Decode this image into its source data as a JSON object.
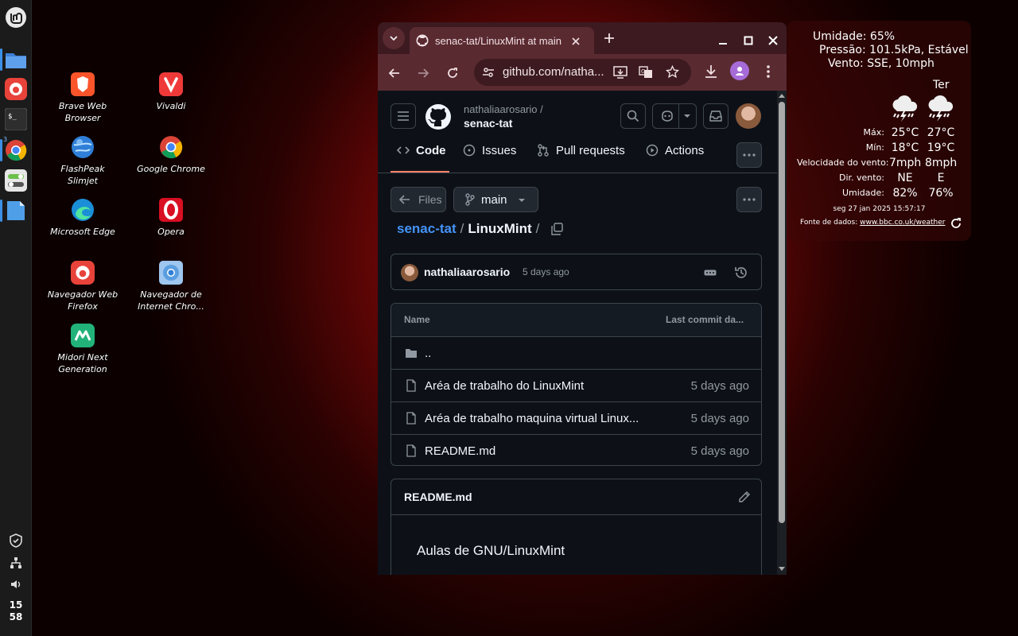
{
  "panel": {
    "clock_hour": "15",
    "clock_minute": "58",
    "chrome_badge": "3"
  },
  "desktop": {
    "icons": [
      {
        "label": "Brave Web Browser"
      },
      {
        "label": "Vivaldi"
      },
      {
        "label": "FlashPeak Slimjet"
      },
      {
        "label": "Google Chrome"
      },
      {
        "label": "Microsoft Edge"
      },
      {
        "label": "Opera"
      },
      {
        "label": "Navegador Web Firefox"
      },
      {
        "label": "Navegador de Internet Chro..."
      },
      {
        "label": "Midori Next Generation"
      }
    ]
  },
  "browser": {
    "tab_title": "senac-tat/LinuxMint at main",
    "url": "github.com/natha...",
    "colors": {
      "frame": "#3c1a20",
      "toolbar": "#5a2a31",
      "accent": "#4493f8"
    }
  },
  "github": {
    "owner": "nathaliaarosario /",
    "repo": "senac-tat",
    "nav": {
      "code": "Code",
      "issues": "Issues",
      "pull_requests": "Pull requests",
      "actions": "Actions"
    },
    "files_button": "Files",
    "branch": "main",
    "breadcrumb": {
      "repo": "senac-tat",
      "sep1": "/",
      "folder": "LinuxMint",
      "sep2": "/"
    },
    "commit": {
      "author": "nathaliaarosario",
      "time": "5 days ago"
    },
    "table": {
      "col_name": "Name",
      "col_date": "Last commit da...",
      "parent": "..",
      "rows": [
        {
          "name": "Aréa de trabalho do LinuxMint",
          "date": "5 days ago"
        },
        {
          "name": "Aréa de trabalho maquina virtual Linux...",
          "date": "5 days ago"
        },
        {
          "name": "README.md",
          "date": "5 days ago"
        }
      ]
    },
    "readme": {
      "title": "README.md",
      "content": "Aulas de GNU/LinuxMint"
    }
  },
  "weather": {
    "humidity": "Umidade: 65%",
    "pressure": "Pressão: 101.5kPa, Estável",
    "wind": "Vento: SSE, 10mph",
    "day2": "Ter",
    "labels": {
      "max": "Máx:",
      "min": "Mín:",
      "wind_speed": "Velocidade do vento:",
      "wind_dir": "Dir. vento:",
      "humidity": "Umidade:"
    },
    "col1": {
      "max": "25°C",
      "min": "18°C",
      "wind_speed": "7mph",
      "wind_dir": "NE",
      "humidity": "82%"
    },
    "col2": {
      "max": "27°C",
      "min": "19°C",
      "wind_speed": "8mph",
      "wind_dir": "E",
      "humidity": "76%"
    },
    "timestamp": "seg 27 jan 2025 15:57:17",
    "source_label": "Fonte de dados:",
    "source_link": "www.bbc.co.uk/weather"
  }
}
